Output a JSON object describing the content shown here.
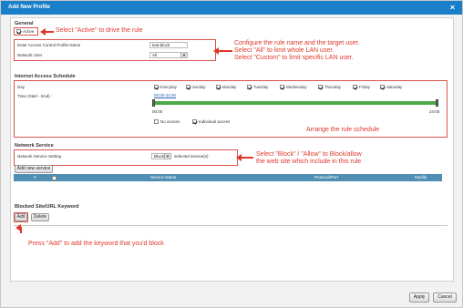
{
  "window": {
    "title": "Add New Profile",
    "close_label": "×"
  },
  "general": {
    "section_title": "General",
    "active_label": "Active",
    "name_label": "Enter Access Control Profile Name",
    "name_value": "test-block",
    "network_user_label": "Network User",
    "network_user_value": "All"
  },
  "schedule": {
    "section_title": "Internet Access Schedule",
    "day_label": "Day",
    "days": [
      "Everyday",
      "Sunday",
      "Monday",
      "Tuesday",
      "Wednesday",
      "Thursday",
      "Friday",
      "Saturday"
    ],
    "time_label": "Time (Start - End) :",
    "time_value": "00:00-24:00",
    "start_label": "00:00",
    "end_label": "24:00",
    "no_access_label": "No access",
    "individual_label": "Individual access"
  },
  "network_service": {
    "section_title": "Network Service",
    "setting_label": "Network Service Setting",
    "block_value": "Block",
    "selected_label": "selected service(s)",
    "add_button": "Add new service",
    "columns": [
      "#",
      "Service Name",
      "Protocol/Port",
      "Modify"
    ]
  },
  "blocked_site": {
    "section_title": "Blocked Site/URL Keyword",
    "add_button": "Add",
    "delete_button": "Delete"
  },
  "footer": {
    "apply_button": "Apply",
    "cancel_button": "Cancel"
  },
  "annotations": {
    "active_note": "Select \"Active\" to drive the rule",
    "config_note_1": "Configure the rule name and the target user.",
    "config_note_2": "Select \"All\" to limit whole LAN user.",
    "config_note_3": "Select \"Custom\" to limit specific LAN user.",
    "schedule_note": "Arrange the rule schedule",
    "service_note_1": "Select \"Block\" / \"Allow\" to Block/allow",
    "service_note_2": "the web site which include in this rule",
    "add_note": "Press \"Add\" to add the keyword that you'd block"
  },
  "colors": {
    "accent": "#1a7fc9",
    "annotation": "#e0382a",
    "slider": "#4fa84a",
    "table_header": "#4f8fb3"
  }
}
